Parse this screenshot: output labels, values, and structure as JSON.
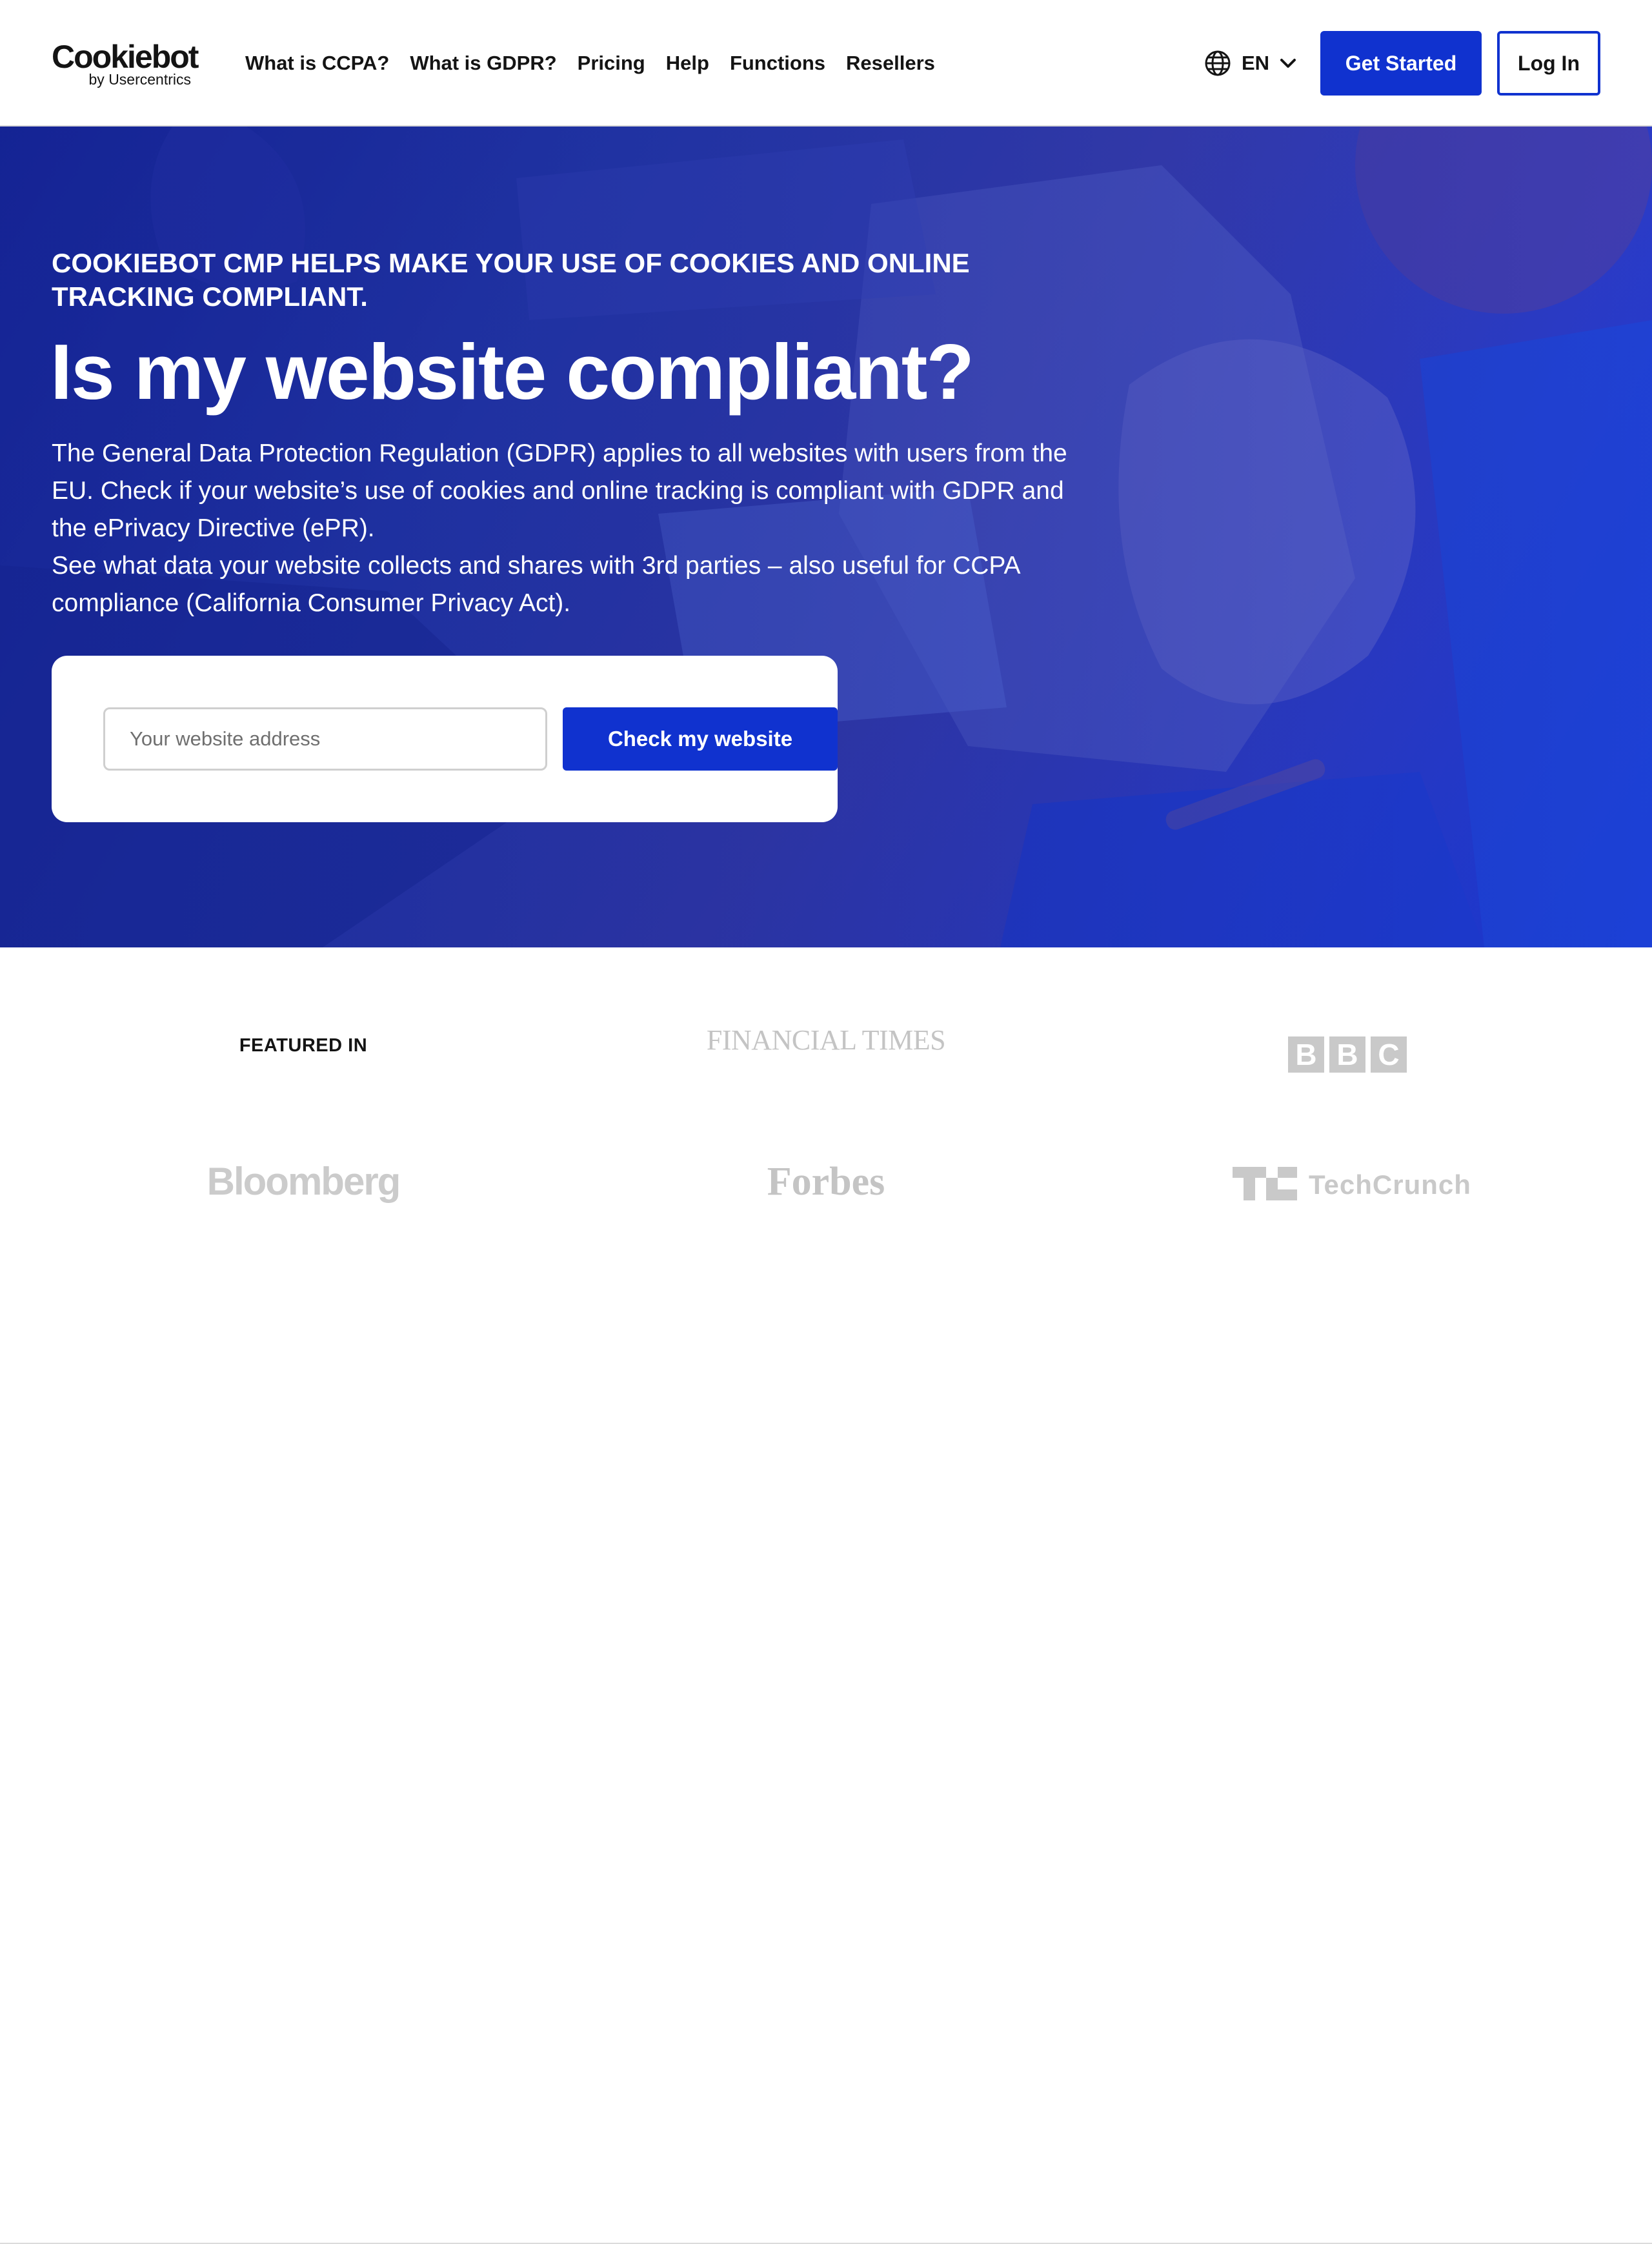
{
  "header": {
    "logo_main": "Cookiebot",
    "logo_sub": "by Usercentrics",
    "nav": [
      {
        "label": "What is CCPA?"
      },
      {
        "label": "What is GDPR?"
      },
      {
        "label": "Pricing"
      },
      {
        "label": "Help"
      },
      {
        "label": "Functions"
      },
      {
        "label": "Resellers"
      }
    ],
    "language": "EN",
    "get_started_label": "Get Started",
    "login_label": "Log In"
  },
  "hero": {
    "eyebrow": "COOKIEBOT CMP HELPS MAKE YOUR USE OF COOKIES AND ONLINE TRACKING COMPLIANT.",
    "title": "Is my website compliant?",
    "paragraph_1": "The General Data Protection Regulation (GDPR) applies to all websites with users from the EU. Check if your website’s use of cookies and online tracking is compliant with GDPR and the ePrivacy Directive (ePR).",
    "paragraph_2": "See what data your website collects and shares with 3rd parties – also useful for CCPA compliance (California Consumer Privacy Act).",
    "input_placeholder": "Your website address",
    "input_value": "",
    "check_button_label": "Check my website"
  },
  "featured": {
    "label": "FEATURED IN",
    "logos": {
      "financial_times": "FINANCIAL TIMES",
      "bbc": [
        "B",
        "B",
        "C"
      ],
      "bloomberg": "Bloomberg",
      "forbes": "Forbes",
      "techcrunch": "TechCrunch"
    }
  },
  "colors": {
    "brand_blue": "#1032cf",
    "hero_dark": "#1a2a9e",
    "logo_gray": "#c4c4c4"
  }
}
